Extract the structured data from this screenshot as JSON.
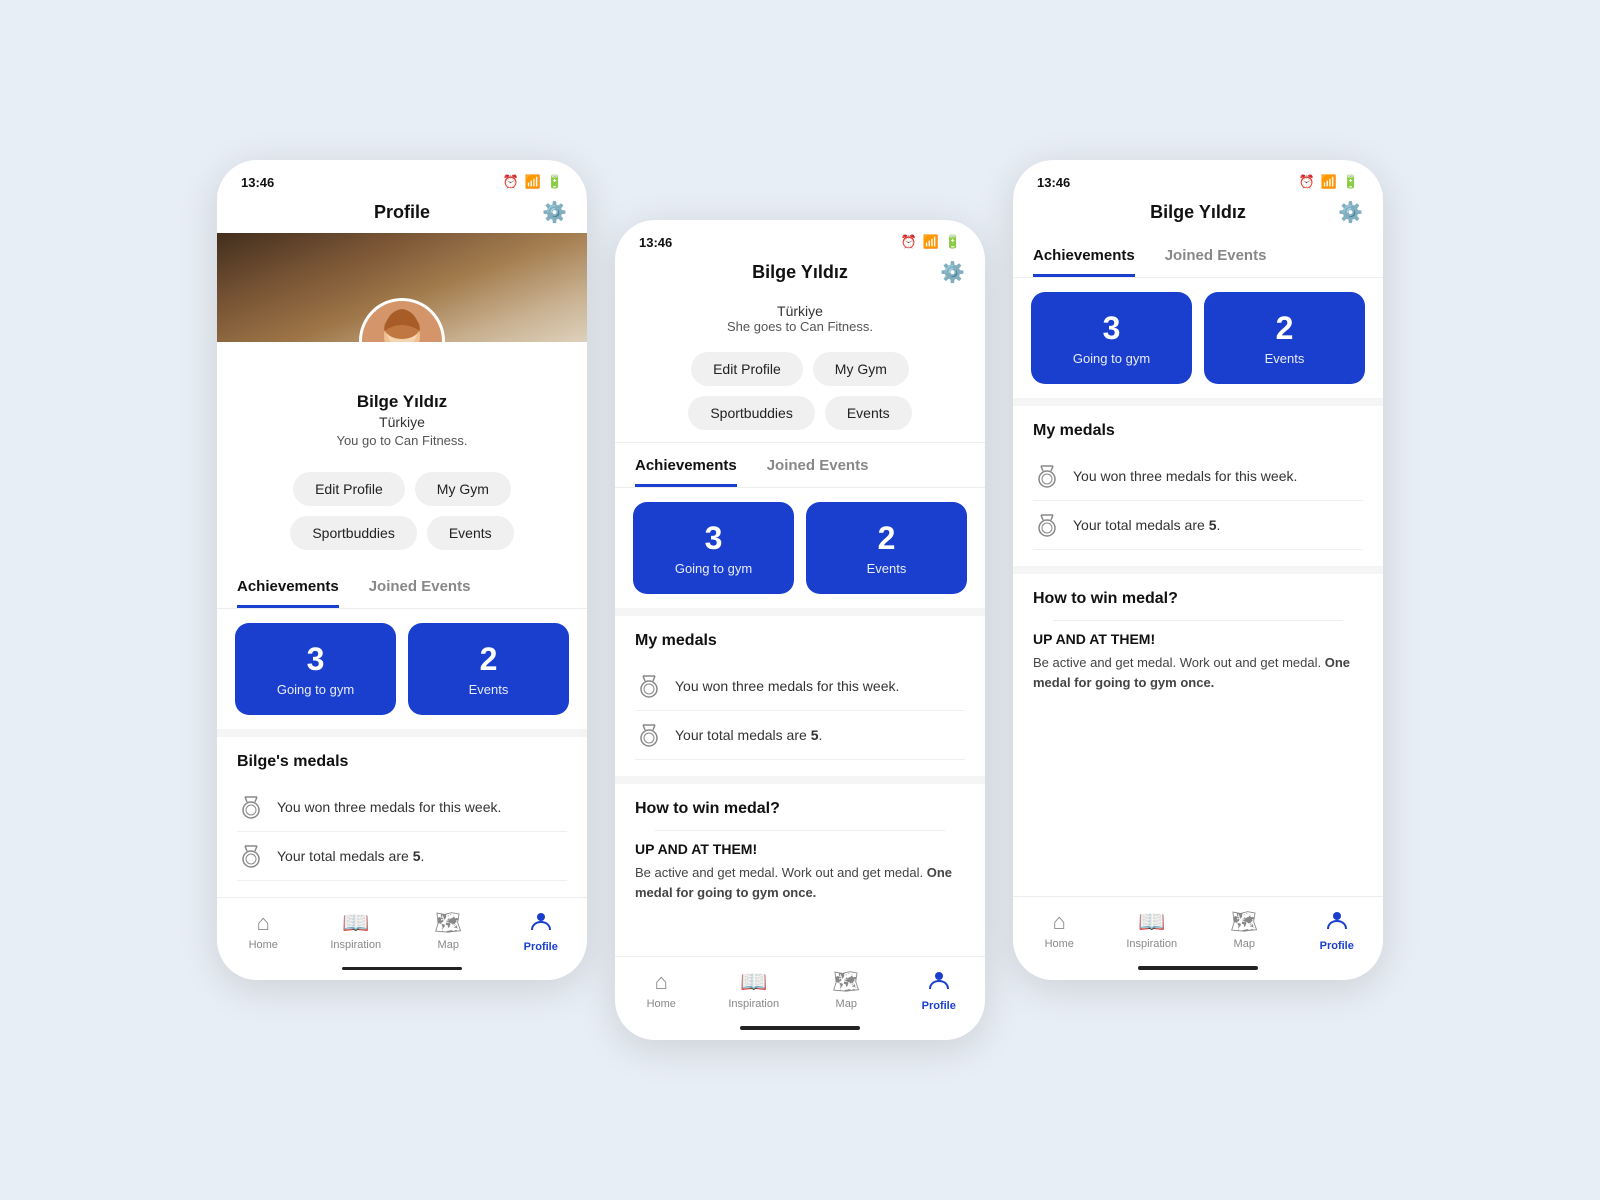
{
  "app": {
    "time": "13:46",
    "status_icons": "⏰ ☁ 🔋"
  },
  "phone1": {
    "header_title": "Profile",
    "user": {
      "name": "Bilge Yıldız",
      "country": "Türkiye",
      "bio": "You go to Can Fitness."
    },
    "buttons": {
      "edit_profile": "Edit Profile",
      "my_gym": "My Gym",
      "sportbuddies": "Sportbuddies",
      "events": "Events"
    },
    "tabs": {
      "achievements": "Achievements",
      "joined_events": "Joined Events"
    },
    "achievement_cards": [
      {
        "number": "3",
        "label": "Going to gym"
      },
      {
        "number": "2",
        "label": "Events"
      }
    ],
    "medals_section_title": "Bilge's medals",
    "medals": [
      {
        "text": "You won three medals for this week."
      },
      {
        "text": "Your total medals are "
      }
    ],
    "medals_total": "5",
    "nav": {
      "home": "Home",
      "inspiration": "Inspiration",
      "map": "Map",
      "profile": "Profile"
    }
  },
  "phone2": {
    "header_title": "Bilge Yıldız",
    "user": {
      "country": "Türkiye",
      "bio": "She goes to Can Fitness."
    },
    "buttons": {
      "edit_profile": "Edit Profile",
      "my_gym": "My Gym",
      "sportbuddies": "Sportbuddies",
      "events": "Events"
    },
    "tabs": {
      "achievements": "Achievements",
      "joined_events": "Joined Events"
    },
    "achievement_cards": [
      {
        "number": "3",
        "label": "Going to gym"
      },
      {
        "number": "2",
        "label": "Events"
      }
    ],
    "medals_section_title": "My medals",
    "medals": [
      {
        "text": "You won three medals for this week."
      },
      {
        "text": "Your total medals are "
      }
    ],
    "medals_total": "5",
    "howto_title": "How to win medal?",
    "howto_subtitle": "UP AND AT THEM!",
    "howto_text_1": "Be active and get medal. Work out and get medal. ",
    "howto_text_bold": "One medal for going to gym once.",
    "nav": {
      "home": "Home",
      "inspiration": "Inspiration",
      "map": "Map",
      "profile": "Profile"
    }
  },
  "phone3": {
    "header_title": "Bilge Yıldız",
    "tabs": {
      "achievements": "Achievements",
      "joined_events": "Joined Events"
    },
    "achievement_cards": [
      {
        "number": "3",
        "label": "Going to gym"
      },
      {
        "number": "2",
        "label": "Events"
      }
    ],
    "medals_section_title": "My medals",
    "medals": [
      {
        "text": "You won three medals for this week."
      },
      {
        "text": "Your total medals are "
      }
    ],
    "medals_total": "5",
    "howto_title": "How to win medal?",
    "howto_subtitle": "UP AND AT THEM!",
    "howto_text_1": "Be active and get medal. Work out and get medal. ",
    "howto_text_bold": "One medal for going to gym once.",
    "nav": {
      "home": "Home",
      "inspiration": "Inspiration",
      "map": "Map",
      "profile": "Profile"
    }
  }
}
